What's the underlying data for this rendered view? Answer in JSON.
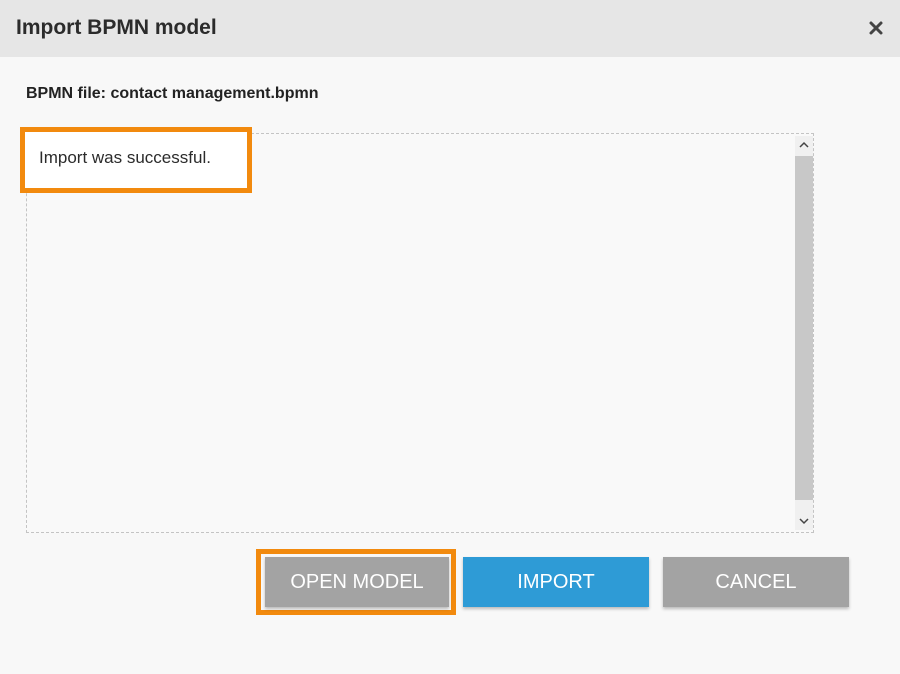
{
  "dialog": {
    "title": "Import BPMN model",
    "close_icon": "close-icon"
  },
  "file": {
    "label": "BPMN file: contact management.bpmn"
  },
  "log": {
    "message": "Import was successful."
  },
  "buttons": {
    "open_model": "OPEN MODEL",
    "import": "IMPORT",
    "cancel": "CANCEL"
  },
  "colors": {
    "highlight": "#f28a0e",
    "primary_button": "#2e9bd6",
    "secondary_button": "#a3a3a3",
    "titlebar": "#e6e6e6"
  }
}
